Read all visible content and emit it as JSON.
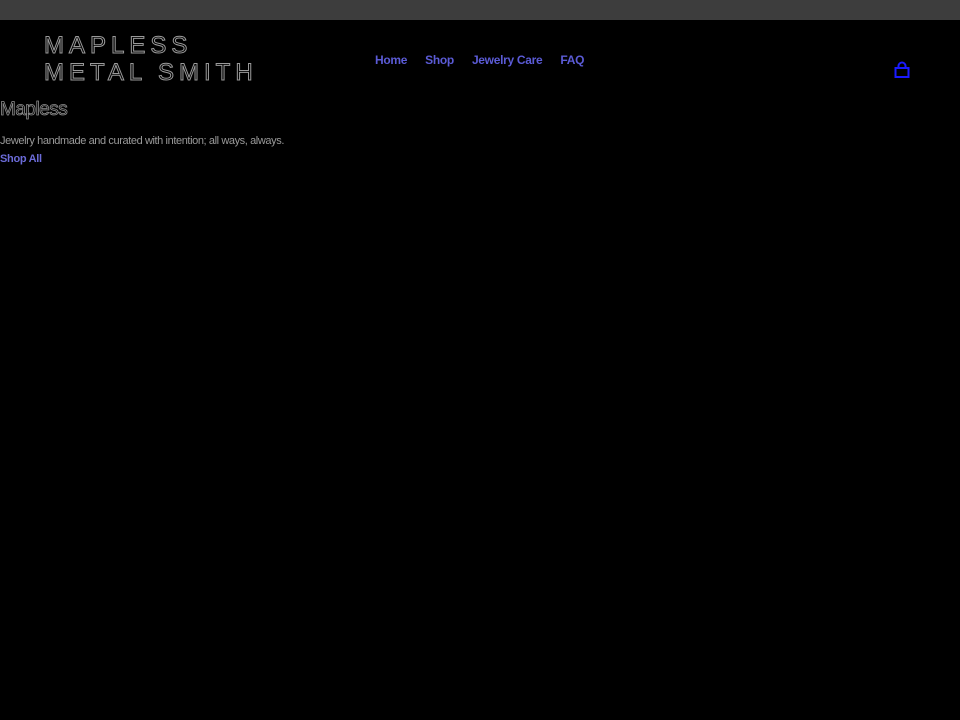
{
  "header": {
    "logo_line1": "MAPLESS",
    "logo_line2": "METAL SMITH",
    "nav": {
      "home": "Home",
      "shop": "Shop",
      "jewelry_care": "Jewelry Care",
      "faq": "FAQ"
    },
    "cart_icon": "shopping-bag-icon"
  },
  "hero": {
    "title": "Mapless",
    "description": "Jewelry handmade and curated with intention; all ways, always.",
    "cta": "Shop All"
  },
  "colors": {
    "background": "#000000",
    "top_strip": "#3d3d3d",
    "link": "#5b5bd6",
    "cart_icon": "#1a1aff",
    "muted_text": "#9a9a9a"
  }
}
